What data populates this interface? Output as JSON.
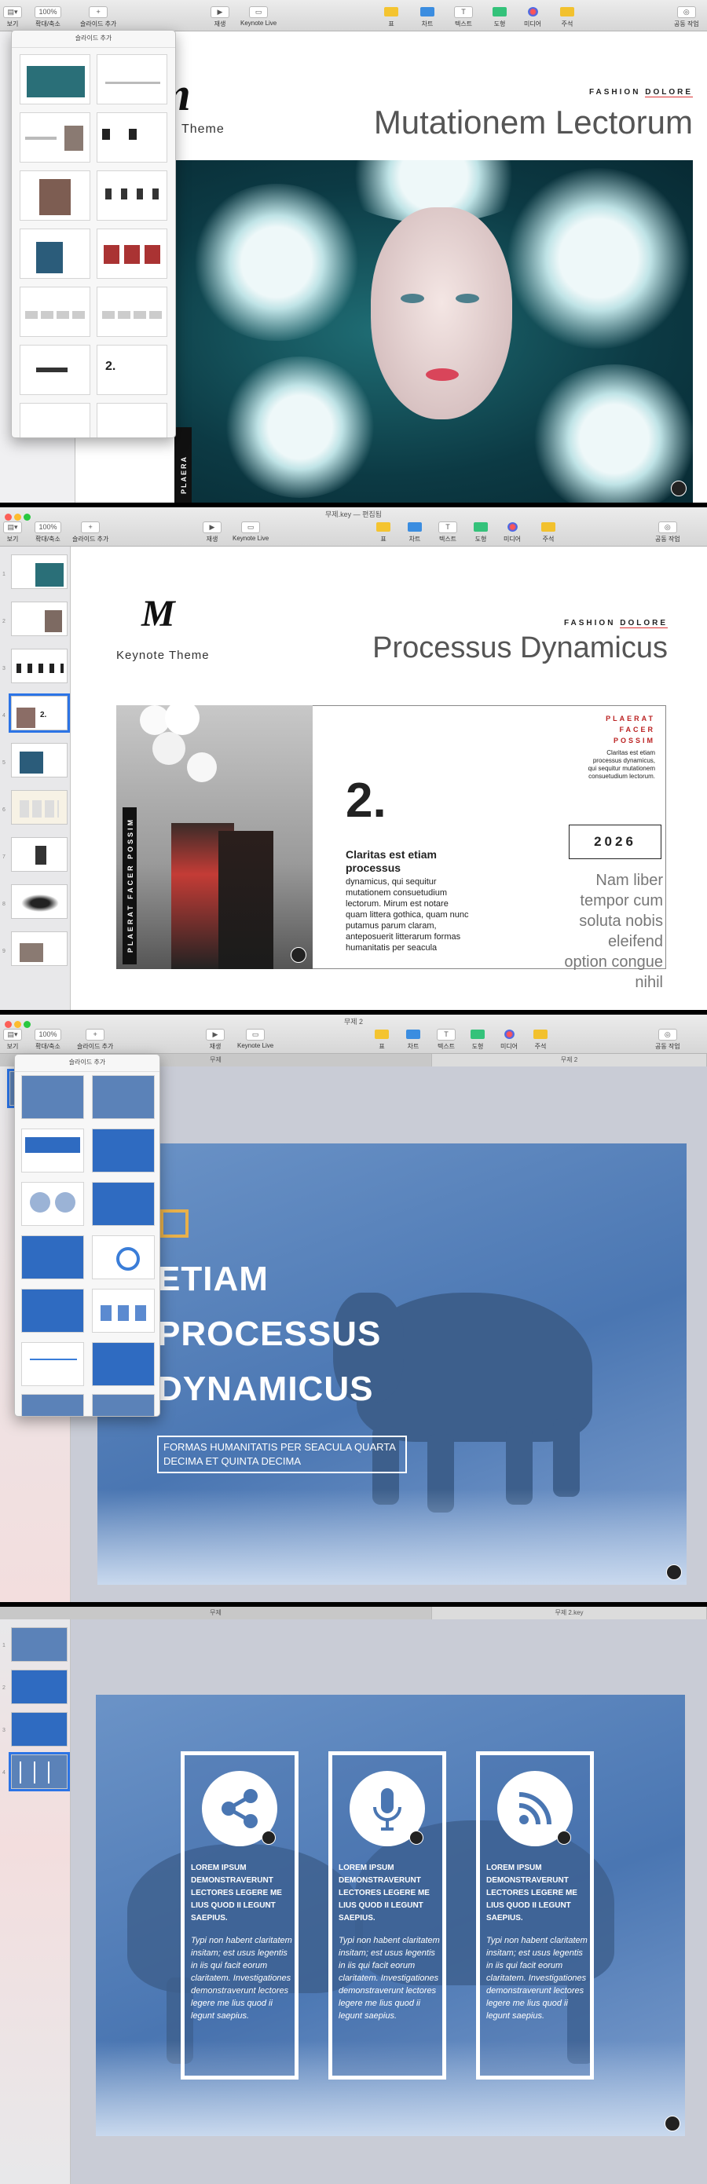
{
  "toolbar": {
    "view": "보기",
    "zoom_value": "100%",
    "zoom": "확대/축소",
    "add_slide": "슬라이드 추가",
    "play": "재생",
    "keynote_live": "Keynote Live",
    "table": "표",
    "chart": "차트",
    "text": "텍스트",
    "shape": "도형",
    "media": "미디어",
    "comment": "주석",
    "collaborate": "공동 작업"
  },
  "window2": {
    "title": "무제.key — 편집됨"
  },
  "window3": {
    "title": "무제 2",
    "tab1": "무제",
    "tab2": "무제 2"
  },
  "window4": {
    "tab1": "무제",
    "tab2": "무제 2.key"
  },
  "popover": {
    "title": "슬라이드 추가"
  },
  "slide1": {
    "brand_tag": "FASHION",
    "brand_tag2": "DOLORE",
    "title": "Mutationem Lectorum",
    "subtitle": "ne Theme",
    "vertical_text": "PLAERA"
  },
  "slide2": {
    "logo": "M",
    "logo_caption": "Keynote Theme",
    "brand_tag": "FASHION",
    "brand_tag2": "DOLORE",
    "title": "Processus Dynamicus",
    "vertical_text": "PLAERAT FACER POSSIM",
    "number": "2.",
    "heading": "Claritas est etiam processus",
    "body": "dynamicus, qui sequitur mutationem consuetudium lectorum. Mirum est notare quam littera gothica, quam nunc putamus parum claram, anteposuerit litterarum formas humanitatis per seacula",
    "box_title": "PLAERAT FACER POSSIM",
    "box_text": "Claritas est etiam processus dynamicus, qui sequitur mutationem consuetudium lectorum.",
    "year": "2026",
    "quote": "Nam liber tempor cum soluta nobis eleifend option congue nihil"
  },
  "slide3": {
    "line1": "ETIAM",
    "line2": "PROCESSUS",
    "line3": "DYNAMICUS",
    "caption": "FORMAS HUMANITATIS PER SEACULA QUARTA DECIMA ET QUINTA DECIMA"
  },
  "slide4": {
    "cards": [
      {
        "icon": "share-icon",
        "head": "LOREM IPSUM DEMONSTRAVERUNT LECTORES LEGERE ME LIUS QUOD II LEGUNT SAEPIUS.",
        "body": "Typi non habent claritatem insitam; est usus legentis in iis qui facit eorum claritatem. Investigationes demonstraverunt lectores legere me lius quod ii legunt saepius."
      },
      {
        "icon": "microphone-icon",
        "head": "LOREM IPSUM DEMONSTRAVERUNT LECTORES LEGERE ME LIUS QUOD II LEGUNT SAEPIUS.",
        "body": "Typi non habent claritatem insitam; est usus legentis in iis qui facit eorum claritatem. Investigationes demonstraverunt lectores legere me lius quod ii legunt saepius."
      },
      {
        "icon": "rss-icon",
        "head": "LOREM IPSUM DEMONSTRAVERUNT LECTORES LEGERE ME LIUS QUOD II LEGUNT SAEPIUS.",
        "body": "Typi non habent claritatem insitam; est usus legentis in iis qui facit eorum claritatem. Investigationes demonstraverunt lectores legere me lius quod ii legunt saepius."
      }
    ]
  },
  "slide_numbers": [
    "1",
    "2",
    "3",
    "4",
    "5",
    "6",
    "7",
    "8",
    "9"
  ]
}
